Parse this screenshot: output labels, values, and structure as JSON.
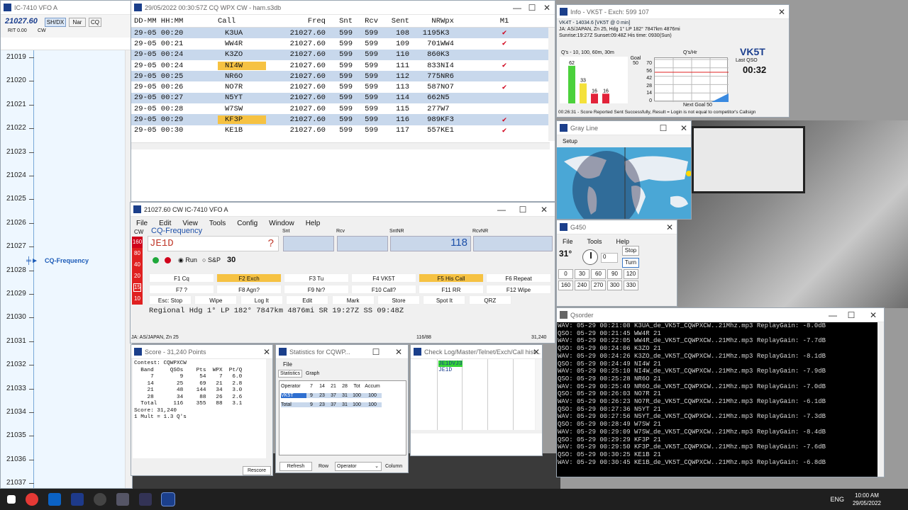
{
  "bandmap": {
    "title": "IC-7410 VFO A",
    "freq": "21027.60",
    "btns": [
      "SH/DX",
      "Nar",
      "CQ"
    ],
    "rit": "RIT  0.00",
    "cw": "CW",
    "cq": "CQ-Frequency",
    "scale": [
      "21019",
      "21020",
      "21021",
      "21022",
      "21023",
      "21024",
      "21025",
      "21026",
      "21027",
      "21028",
      "21029",
      "21030",
      "21031",
      "21032",
      "21033",
      "21034",
      "21035",
      "21036",
      "21037"
    ]
  },
  "log": {
    "title": "29/05/2022 00:30:57Z  CQ WPX  CW - ham.s3db",
    "cols": [
      "DD-MM HH:MM",
      "Call",
      "Freq",
      "Snt",
      "Rcv",
      "Sent",
      "NR",
      "Wpx",
      "M1"
    ],
    "rows": [
      [
        "29-05 00:20",
        "K3UA",
        "21027.60",
        "599",
        "599",
        "108",
        "1195",
        "K3",
        "✔"
      ],
      [
        "29-05 00:21",
        "WW4R",
        "21027.60",
        "599",
        "599",
        "109",
        "701",
        "WW4",
        "✔"
      ],
      [
        "29-05 00:24",
        "K3ZO",
        "21027.60",
        "599",
        "599",
        "110",
        "860",
        "K3",
        ""
      ],
      [
        "29-05 00:24",
        "NI4W",
        "21027.60",
        "599",
        "599",
        "111",
        "833",
        "NI4",
        "✔"
      ],
      [
        "29-05 00:25",
        "NR6O",
        "21027.60",
        "599",
        "599",
        "112",
        "775",
        "NR6",
        ""
      ],
      [
        "29-05 00:26",
        "NO7R",
        "21027.60",
        "599",
        "599",
        "113",
        "587",
        "NO7",
        "✔"
      ],
      [
        "29-05 00:27",
        "N5YT",
        "21027.60",
        "599",
        "599",
        "114",
        "662",
        "N5",
        ""
      ],
      [
        "29-05 00:28",
        "W7SW",
        "21027.60",
        "599",
        "599",
        "115",
        "277",
        "W7",
        ""
      ],
      [
        "29-05 00:29",
        "KF3P",
        "21027.60",
        "599",
        "599",
        "116",
        "989",
        "KF3",
        "✔"
      ],
      [
        "29-05 00:30",
        "KE1B",
        "21027.60",
        "599",
        "599",
        "117",
        "557",
        "KE1",
        "✔"
      ]
    ]
  },
  "entry": {
    "title": "21027.60 CW IC-7410 VFO A",
    "menu": [
      "File",
      "Edit",
      "View",
      "Tools",
      "Config",
      "Window",
      "Help"
    ],
    "mode": "CW",
    "freqLabel": "CQ-Frequency",
    "call": "JE1D",
    "q": "?",
    "labels": [
      "Snt",
      "Rcv",
      "SntNR",
      "RcvNR"
    ],
    "sntnr": "118",
    "run": "Run",
    "sp": "S&P",
    "num": "30",
    "fkeys": [
      [
        "F1 Cq",
        "F2 Exch",
        "F3 Tu",
        "F4 VK5T",
        "F5 His Call",
        "F6 Repeat"
      ],
      [
        "F7 ?",
        "F8 Agn?",
        "F9 Nr?",
        "F10 Call?",
        "F11 RR",
        "F12 Wipe"
      ],
      [
        "Esc: Stop",
        "Wipe",
        "Log It",
        "Edit",
        "Mark",
        "Store",
        "Spot It",
        "QRZ"
      ]
    ],
    "bands": [
      "160",
      "80",
      "40",
      "20",
      "15",
      "10"
    ],
    "info": "Regional Hdg 1° LP 182° 7847km 4876mi SR 19:27Z SS 09:48Z",
    "status1": "JA: AS/JAPAN, Zn 25",
    "status2": "116/88",
    "status3": "31,240"
  },
  "info": {
    "title": "Info - VK5T - Exch: 599 107",
    "l1": "VK4T - 14034.6 [VK5T @ 0 min]",
    "l2": "JA: AS/JAPAN, Zn 25, Hdg 1° LP 182° 7847km 4876mi",
    "l3": "Sunrise:19:27Z Sunset:09:48Z His time: 0930(Sun)",
    "qs": "Q's - 10, 100, 60m, 30m",
    "goal": "Goal 50",
    "qhr": "Q's/Hr",
    "call": "VK5T",
    "lastlbl": "Last QSO",
    "last": "00:32",
    "bars": [
      "62",
      "33",
      "16",
      "16"
    ],
    "ticks": [
      "70",
      "56",
      "42",
      "28",
      "14",
      "0"
    ],
    "next": "Next Goal 50",
    "msg": "00:26:31 - Score Reported Sent Successfully, Result = Login is not equal to competitor's Callsign"
  },
  "gray": {
    "title": "Gray Line",
    "setup": "Setup"
  },
  "g450": {
    "title": "G450",
    "menu": [
      "File",
      "Tools",
      "Help"
    ],
    "deg": "31°",
    "val": "0",
    "stop": "Stop",
    "turn": "Turn",
    "btns": [
      "0",
      "30",
      "60",
      "90",
      "120",
      "160",
      "240",
      "270",
      "300",
      "330"
    ]
  },
  "qsorder": {
    "title": "Qsorder",
    "lines": [
      "WAV: 05-29 00:21:08 K3UA_de_VK5T_CQWPXCW..21Mhz.mp3 ReplayGain: -8.0dB",
      "QSO: 05-29 00:21:45 WW4R 21",
      "WAV: 05-29 00:22:05 WW4R_de_VK5T_CQWPXCW..21Mhz.mp3 ReplayGain: -7.7dB",
      "QSO: 05-29 00:24:06 K3ZO 21",
      "WAV: 05-29 00:24:26 K3ZO_de_VK5T_CQWPXCW..21Mhz.mp3 ReplayGain: -8.1dB",
      "QSO: 05-29 00:24:49 NI4W 21",
      "WAV: 05-29 00:25:10 NI4W_de_VK5T_CQWPXCW..21Mhz.mp3 ReplayGain: -7.9dB",
      "QSO: 05-29 00:25:28 NR6O 21",
      "WAV: 05-29 00:25:49 NR6O_de_VK5T_CQWPXCW..21Mhz.mp3 ReplayGain: -7.0dB",
      "QSO: 05-29 00:26:03 NO7R 21",
      "WAV: 05-29 00:26:23 NO7R_de_VK5T_CQWPXCW..21Mhz.mp3 ReplayGain: -6.1dB",
      "QSO: 05-29 00:27:36 N5YT 21",
      "WAV: 05-29 00:27:56 N5YT_de_VK5T_CQWPXCW..21Mhz.mp3 ReplayGain: -7.3dB",
      "QSO: 05-29 00:28:49 W7SW 21",
      "WAV: 05-29 00:29:09 W7SW_de_VK5T_CQWPXCW..21Mhz.mp3 ReplayGain: -8.4dB",
      "QSO: 05-29 00:29:29 KF3P 21",
      "WAV: 05-29 00:29:50 KF3P_de_VK5T_CQWPXCW..21Mhz.mp3 ReplayGain: -7.6dB",
      "QSO: 05-29 00:30:25 KE1B 21",
      "WAV: 05-29 00:30:45 KE1B_de_VK5T_CQWPXCW..21Mhz.mp3 ReplayGain: -6.8dB"
    ]
  },
  "score": {
    "title": "Score - 31,240 Points",
    "lines": [
      "Contest: CQWPXCW",
      "  Band     QSOs    Pts  WPX  Pt/Q",
      "     7        9     54    7   6.0",
      "    14       25     69   21   2.8",
      "    21       48    144   34   3.0",
      "    28       34     88   26   2.6",
      "  Total     116    355   88   3.1",
      "Score: 31,240",
      "1 Mult = 1.3 Q's"
    ],
    "rescore": "Rescore"
  },
  "stats": {
    "title": "Statistics for CQWP...",
    "file": "File",
    "tabs": [
      "Statistics",
      "Graph"
    ],
    "head": [
      "Operator",
      "7",
      "14",
      "21",
      "28",
      "Tot",
      "Accum"
    ],
    "r1": [
      "VK5T",
      "9",
      "23",
      "37",
      "31",
      "100",
      "100"
    ],
    "r2": [
      "Total",
      "9",
      "23",
      "37",
      "31",
      "100",
      "100"
    ],
    "refresh": "Refresh",
    "row": "Row",
    "operator": "Operator",
    "column": "Column"
  },
  "check": {
    "title": "Check Log/Master/Telnet/Exch/Call hist...",
    "c1": "JE1DVJ3",
    "c2": "JE1D"
  },
  "clock": {
    "time": "10:00 AM",
    "date": "29/05/2022",
    "lang": "ENG"
  }
}
